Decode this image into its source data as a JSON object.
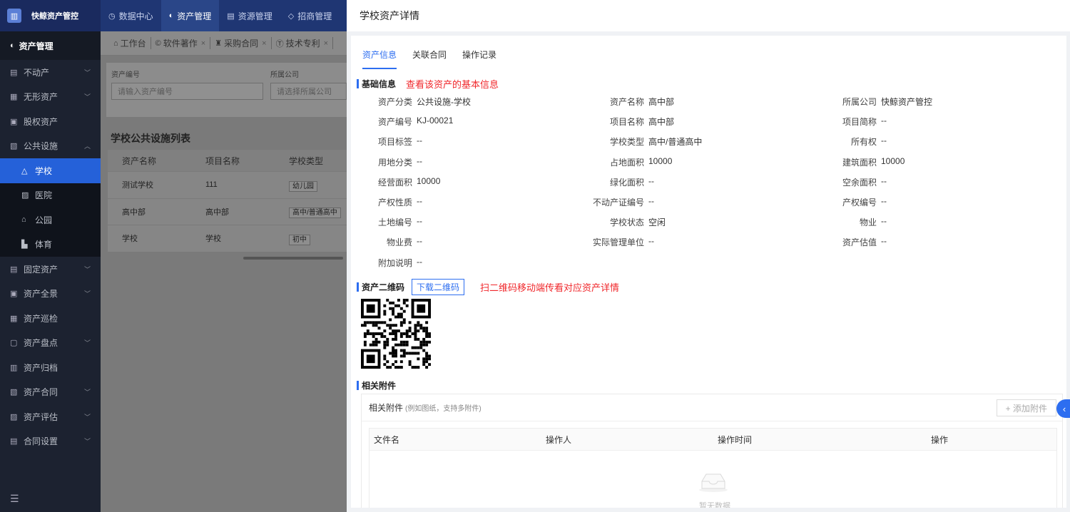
{
  "app": {
    "name": "快鲸资产管控",
    "logo_glyph": "▥"
  },
  "sidebar": {
    "header": "资产管理",
    "items": [
      {
        "icon": "building-icon",
        "glyph": "▤",
        "label": "不动产",
        "chevron": "﹀"
      },
      {
        "icon": "doc-icon",
        "glyph": "▦",
        "label": "无形资产",
        "chevron": "﹀"
      },
      {
        "icon": "equity-icon",
        "glyph": "▣",
        "label": "股权资产",
        "chevron": ""
      },
      {
        "icon": "facility-icon",
        "glyph": "▧",
        "label": "公共设施",
        "chevron": "︿"
      }
    ],
    "subitems": [
      {
        "icon": "school-icon",
        "glyph": "△",
        "label": "学校",
        "active": true
      },
      {
        "icon": "hospital-icon",
        "glyph": "▨",
        "label": "医院",
        "active": false
      },
      {
        "icon": "park-icon",
        "glyph": "⌂",
        "label": "公园",
        "active": false
      },
      {
        "icon": "sports-icon",
        "glyph": "▙",
        "label": "体育",
        "active": false
      }
    ],
    "items2": [
      {
        "icon": "fixed-asset-icon",
        "glyph": "▤",
        "label": "固定资产",
        "chevron": "﹀"
      },
      {
        "icon": "panorama-icon",
        "glyph": "▣",
        "label": "资产全景",
        "chevron": "﹀"
      },
      {
        "icon": "inspect-icon",
        "glyph": "▦",
        "label": "资产巡检",
        "chevron": ""
      },
      {
        "icon": "inventory-icon",
        "glyph": "▢",
        "label": "资产盘点",
        "chevron": "﹀"
      },
      {
        "icon": "archive-icon",
        "glyph": "▥",
        "label": "资产归档",
        "chevron": ""
      },
      {
        "icon": "contract-icon",
        "glyph": "▧",
        "label": "资产合同",
        "chevron": "﹀"
      },
      {
        "icon": "evaluate-icon",
        "glyph": "▨",
        "label": "资产评估",
        "chevron": "﹀"
      },
      {
        "icon": "contract-settings-icon",
        "glyph": "▤",
        "label": "合同设置",
        "chevron": "﹀"
      }
    ],
    "collapse_glyph": "☰"
  },
  "topnav": [
    {
      "icon": "dashboard-icon",
      "glyph": "◷",
      "label": "数据中心",
      "active": false
    },
    {
      "icon": "asset-icon",
      "glyph": "◐",
      "label": "资产管理",
      "active": true
    },
    {
      "icon": "resource-icon",
      "glyph": "▤",
      "label": "资源管理",
      "active": false
    },
    {
      "icon": "invest-icon",
      "glyph": "◇",
      "label": "招商管理",
      "active": false
    }
  ],
  "tabstrip": [
    {
      "glyph": "⌂",
      "label": "工作台",
      "closable": false
    },
    {
      "glyph": "©",
      "label": "软件著作",
      "closable": true
    },
    {
      "glyph": "♜",
      "label": "采购合同",
      "closable": true
    },
    {
      "glyph": "Ⓣ",
      "label": "技术专利",
      "closable": true
    }
  ],
  "filters": {
    "asset_no_label": "资产编号",
    "asset_no_placeholder": "请输入资产编号",
    "company_label": "所属公司",
    "company_placeholder": "请选择所属公司"
  },
  "list": {
    "title": "学校公共设施列表",
    "columns": [
      "资产名称",
      "项目名称",
      "学校类型"
    ],
    "rows": [
      [
        "测试学校",
        "111",
        "幼儿园"
      ],
      [
        "高中部",
        "高中部",
        "高中/普通高中"
      ],
      [
        "学校",
        "学校",
        "初中"
      ]
    ]
  },
  "drawer": {
    "title": "学校资产详情",
    "tabs": [
      "资产信息",
      "关联合同",
      "操作记录"
    ],
    "basic_title": "基础信息",
    "basic_hint": "查看该资产的基本信息",
    "fields": [
      {
        "k": "资产分类",
        "v": "公共设施-学校"
      },
      {
        "k": "资产名称",
        "v": "高中部"
      },
      {
        "k": "所属公司",
        "v": "快鲸资产管控"
      },
      {
        "k": "资产编号",
        "v": "KJ-00021"
      },
      {
        "k": "项目名称",
        "v": "高中部"
      },
      {
        "k": "项目简称",
        "v": "--"
      },
      {
        "k": "项目标签",
        "v": "--"
      },
      {
        "k": "学校类型",
        "v": "高中/普通高中"
      },
      {
        "k": "所有权",
        "v": "--"
      },
      {
        "k": "用地分类",
        "v": "--"
      },
      {
        "k": "占地面积",
        "v": "10000"
      },
      {
        "k": "建筑面积",
        "v": "10000"
      },
      {
        "k": "经营面积",
        "v": "10000"
      },
      {
        "k": "绿化面积",
        "v": "--"
      },
      {
        "k": "空余面积",
        "v": "--"
      },
      {
        "k": "产权性质",
        "v": "--"
      },
      {
        "k": "不动产证编号",
        "v": "--"
      },
      {
        "k": "产权编号",
        "v": "--"
      },
      {
        "k": "土地编号",
        "v": "--"
      },
      {
        "k": "学校状态",
        "v": " 空闲"
      },
      {
        "k": "物业",
        "v": "--"
      },
      {
        "k": "物业费",
        "v": "--"
      },
      {
        "k": "实际管理单位",
        "v": "--"
      },
      {
        "k": "资产估值",
        "v": "--"
      },
      {
        "k": "附加说明",
        "v": "--"
      }
    ],
    "qr_title": "资产二维码",
    "qr_download": "下载二维码",
    "qr_hint": "扫二维码移动端传看对应资产详情",
    "attach_title": "相关附件",
    "attach_label": "相关附件",
    "attach_sub": "(例如图纸，支持多附件)",
    "attach_add": "+ 添加附件",
    "attach_columns": [
      "文件名",
      "操作人",
      "操作时间",
      "操作"
    ],
    "empty_text": "暂无数据"
  },
  "colors": {
    "accent": "#2d6ef0",
    "hint": "#f0272b",
    "sidebar_bg": "#1c2230",
    "topbar_bg": "#1f3673"
  }
}
